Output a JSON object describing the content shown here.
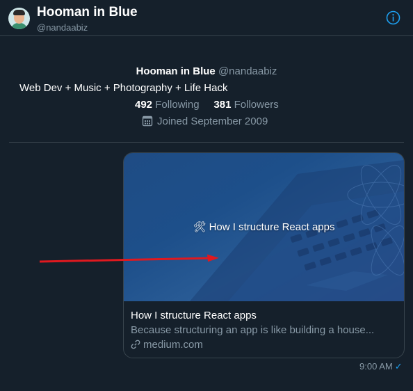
{
  "header": {
    "title": "Hooman in Blue",
    "handle": "@nandaabiz",
    "info_icon": "info-icon"
  },
  "profile": {
    "name": "Hooman in Blue",
    "handle": "@nandaabiz",
    "bio": "Web Dev + Music + Photography + Life Hack",
    "following_count": "492",
    "following_label": "Following",
    "followers_count": "381",
    "followers_label": "Followers",
    "joined": "Joined September 2009",
    "joined_icon": "calendar-icon"
  },
  "message": {
    "card": {
      "image_caption": "How I structure React apps",
      "image_icon": "hammer-and-wrench-icon",
      "title": "How I structure React apps",
      "description": "Because structuring an app is like building a house...",
      "domain": "medium.com",
      "domain_icon": "link-icon"
    },
    "time": "9:00 AM",
    "status_icon": "checkmark-icon"
  },
  "annotation": {
    "arrow_icon": "red-arrow-icon",
    "color": "#e0191f"
  },
  "colors": {
    "background": "#15202b",
    "accent": "#1da1f2",
    "muted_text": "#8899a6",
    "border": "#38444d"
  }
}
